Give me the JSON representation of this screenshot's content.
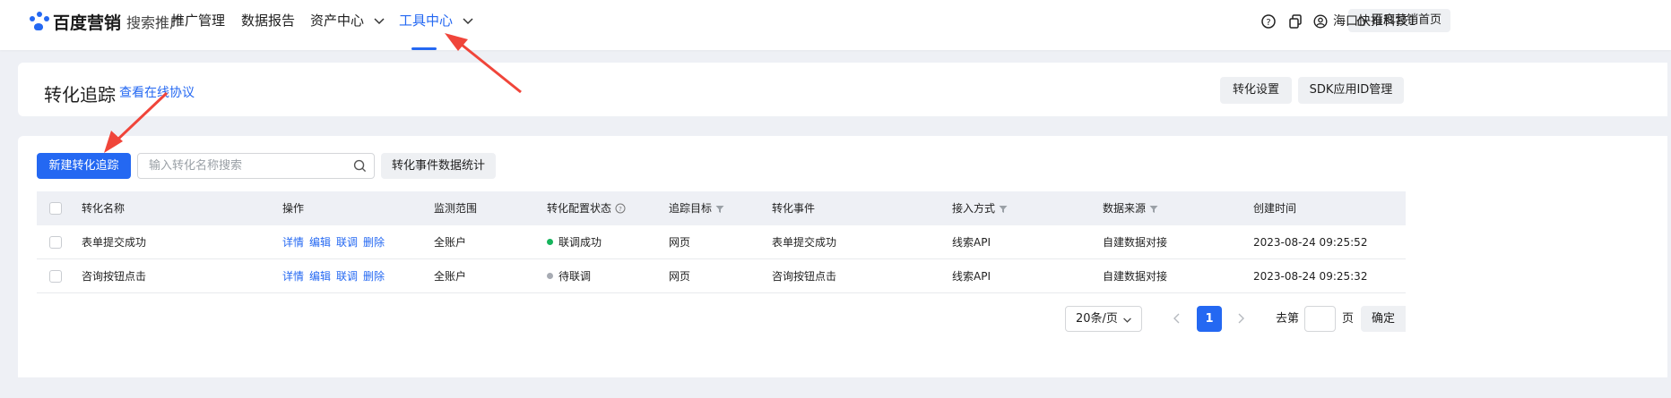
{
  "nav": {
    "brand": "百度营销",
    "product": "搜索推广",
    "items": [
      {
        "label": "推广管理"
      },
      {
        "label": "数据报告"
      },
      {
        "label": "资产中心"
      },
      {
        "label": "工具中心"
      }
    ],
    "home_label": "百度营销首页",
    "account_name": "海口快推科技1",
    "icons": [
      "help-icon",
      "copy-icon",
      "user-icon",
      "home-icon"
    ]
  },
  "header": {
    "title": "转化追踪",
    "protocol_link": "查看在线协议",
    "settings_button": "转化设置",
    "sdk_button": "SDK应用ID管理"
  },
  "toolbar": {
    "new_button": "新建转化追踪",
    "search_placeholder": "输入转化名称搜索",
    "stats_button": "转化事件数据统计"
  },
  "table": {
    "columns": [
      "转化名称",
      "操作",
      "监测范围",
      "转化配置状态",
      "追踪目标",
      "转化事件",
      "接入方式",
      "数据来源",
      "创建时间"
    ],
    "rows": [
      {
        "name": "表单提交成功",
        "actions": [
          "详情",
          "编辑",
          "联调",
          "删除"
        ],
        "scope": "全账户",
        "status": "联调成功",
        "target": "网页",
        "event": "表单提交成功",
        "access": "线索API",
        "source": "自建数据对接",
        "created": "2023-08-24 09:25:52"
      },
      {
        "name": "咨询按钮点击",
        "actions": [
          "详情",
          "编辑",
          "联调",
          "删除"
        ],
        "scope": "全账户",
        "status": "待联调",
        "target": "网页",
        "event": "咨询按钮点击",
        "access": "线索API",
        "source": "自建数据对接",
        "created": "2023-08-24 09:25:32"
      }
    ]
  },
  "pagination": {
    "page_size": "20条/页",
    "current_page": "1",
    "goto_prefix": "去第",
    "goto_suffix": "页",
    "confirm": "确定"
  },
  "colors": {
    "accent": "#2468f2",
    "status_success": "#16b45c",
    "status_pending": "#a7abb3",
    "annotation_arrow": "#f0453a"
  }
}
